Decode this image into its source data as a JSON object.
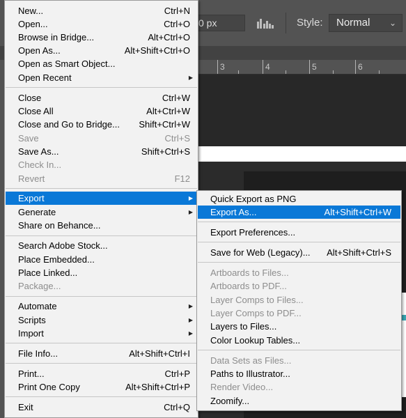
{
  "options_bar": {
    "width_value": "0 px",
    "aspect_icon": "ratio-swap-icon",
    "style_label": "Style:",
    "style_value": "Normal",
    "style_chevron": "⌄"
  },
  "ruler": {
    "numbers": [
      "3",
      "4",
      "5",
      "6"
    ]
  },
  "file_menu": {
    "items": [
      {
        "label": "New...",
        "shortcut": "Ctrl+N"
      },
      {
        "label": "Open...",
        "shortcut": "Ctrl+O"
      },
      {
        "label": "Browse in Bridge...",
        "shortcut": "Alt+Ctrl+O"
      },
      {
        "label": "Open As...",
        "shortcut": "Alt+Shift+Ctrl+O"
      },
      {
        "label": "Open as Smart Object...",
        "shortcut": ""
      },
      {
        "label": "Open Recent",
        "shortcut": "",
        "submenu": true
      },
      {
        "label": "Close",
        "shortcut": "Ctrl+W"
      },
      {
        "label": "Close All",
        "shortcut": "Alt+Ctrl+W"
      },
      {
        "label": "Close and Go to Bridge...",
        "shortcut": "Shift+Ctrl+W"
      },
      {
        "label": "Save",
        "shortcut": "Ctrl+S",
        "disabled": true
      },
      {
        "label": "Save As...",
        "shortcut": "Shift+Ctrl+S"
      },
      {
        "label": "Check In...",
        "shortcut": "",
        "disabled": true
      },
      {
        "label": "Revert",
        "shortcut": "F12",
        "disabled": true
      },
      {
        "label": "Export",
        "shortcut": "",
        "submenu": true,
        "highlighted": true
      },
      {
        "label": "Generate",
        "shortcut": "",
        "submenu": true
      },
      {
        "label": "Share on Behance...",
        "shortcut": ""
      },
      {
        "label": "Search Adobe Stock...",
        "shortcut": ""
      },
      {
        "label": "Place Embedded...",
        "shortcut": ""
      },
      {
        "label": "Place Linked...",
        "shortcut": ""
      },
      {
        "label": "Package...",
        "shortcut": "",
        "disabled": true
      },
      {
        "label": "Automate",
        "shortcut": "",
        "submenu": true
      },
      {
        "label": "Scripts",
        "shortcut": "",
        "submenu": true
      },
      {
        "label": "Import",
        "shortcut": "",
        "submenu": true
      },
      {
        "label": "File Info...",
        "shortcut": "Alt+Shift+Ctrl+I"
      },
      {
        "label": "Print...",
        "shortcut": "Ctrl+P"
      },
      {
        "label": "Print One Copy",
        "shortcut": "Alt+Shift+Ctrl+P"
      },
      {
        "label": "Exit",
        "shortcut": "Ctrl+Q"
      }
    ],
    "submenu_arrow": "▶"
  },
  "export_menu": {
    "items": [
      {
        "label": "Quick Export as PNG",
        "shortcut": ""
      },
      {
        "label": "Export As...",
        "shortcut": "Alt+Shift+Ctrl+W",
        "highlighted": true
      },
      {
        "label": "Export Preferences...",
        "shortcut": ""
      },
      {
        "label": "Save for Web (Legacy)...",
        "shortcut": "Alt+Shift+Ctrl+S"
      },
      {
        "label": "Artboards to Files...",
        "shortcut": "",
        "disabled": true
      },
      {
        "label": "Artboards to PDF...",
        "shortcut": "",
        "disabled": true
      },
      {
        "label": "Layer Comps to Files...",
        "shortcut": "",
        "disabled": true
      },
      {
        "label": "Layer Comps to PDF...",
        "shortcut": "",
        "disabled": true
      },
      {
        "label": "Layers to Files...",
        "shortcut": ""
      },
      {
        "label": "Color Lookup Tables...",
        "shortcut": ""
      },
      {
        "label": "Data Sets as Files...",
        "shortcut": "",
        "disabled": true
      },
      {
        "label": "Paths to Illustrator...",
        "shortcut": ""
      },
      {
        "label": "Render Video...",
        "shortcut": "",
        "disabled": true
      },
      {
        "label": "Zoomify...",
        "shortcut": ""
      }
    ]
  },
  "colors": {
    "menu_bg": "#f2f2f2",
    "highlight": "#0a78d7",
    "disabled_text": "#8d8d8d",
    "app_bg": "#535353"
  }
}
